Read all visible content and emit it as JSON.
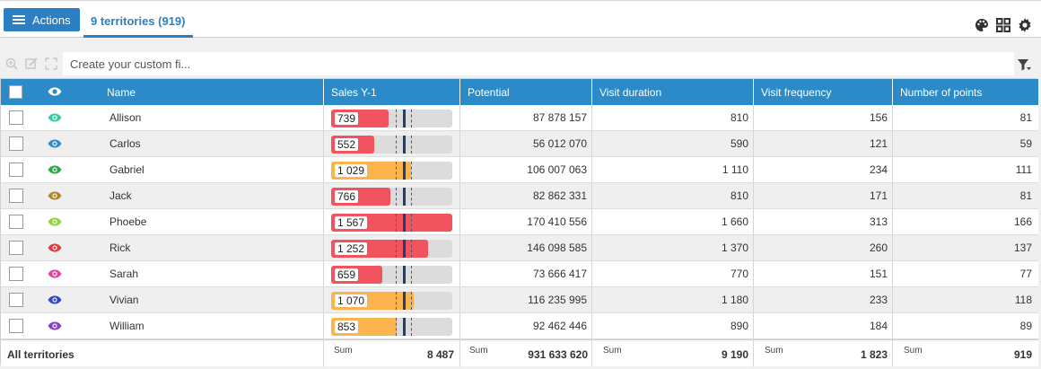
{
  "toolbar": {
    "actions_label": "Actions",
    "tab_label": "9 territories (919)"
  },
  "filter": {
    "placeholder": "Create your custom fi..."
  },
  "columns": [
    "Name",
    "Sales Y-1",
    "Potential",
    "Visit duration",
    "Visit frequency",
    "Number of points"
  ],
  "colors": {
    "header": "#2a8bc8",
    "accent": "#2b7fc2",
    "bar_red": "#f2545f",
    "bar_orange": "#fbb44e",
    "bar_track": "#dcdcdc",
    "target_marker": "#1f3f73"
  },
  "bar_max": 1567,
  "rows": [
    {
      "name": "Allison",
      "eye_color": "#3cc9a6",
      "sales": "739",
      "sales_value": 739,
      "bar_color": "#f2545f",
      "potential": "87 878 157",
      "visit_duration": "810",
      "visit_frequency": "156",
      "points": "81"
    },
    {
      "name": "Carlos",
      "eye_color": "#2e8fc9",
      "sales": "552",
      "sales_value": 552,
      "bar_color": "#f2545f",
      "potential": "56 012 070",
      "visit_duration": "590",
      "visit_frequency": "121",
      "points": "59"
    },
    {
      "name": "Gabriel",
      "eye_color": "#2ea84a",
      "sales": "1 029",
      "sales_value": 1029,
      "bar_color": "#fbb44e",
      "potential": "106 007 063",
      "visit_duration": "1 110",
      "visit_frequency": "234",
      "points": "111"
    },
    {
      "name": "Jack",
      "eye_color": "#b0852d",
      "sales": "766",
      "sales_value": 766,
      "bar_color": "#f2545f",
      "potential": "82 862 331",
      "visit_duration": "810",
      "visit_frequency": "171",
      "points": "81"
    },
    {
      "name": "Phoebe",
      "eye_color": "#8fd43e",
      "sales": "1 567",
      "sales_value": 1567,
      "bar_color": "#f2545f",
      "potential": "170 410 556",
      "visit_duration": "1 660",
      "visit_frequency": "313",
      "points": "166"
    },
    {
      "name": "Rick",
      "eye_color": "#e53a3a",
      "sales": "1 252",
      "sales_value": 1252,
      "bar_color": "#f2545f",
      "potential": "146 098 585",
      "visit_duration": "1 370",
      "visit_frequency": "260",
      "points": "137"
    },
    {
      "name": "Sarah",
      "eye_color": "#e0459e",
      "sales": "659",
      "sales_value": 659,
      "bar_color": "#f2545f",
      "potential": "73 666 417",
      "visit_duration": "770",
      "visit_frequency": "151",
      "points": "77"
    },
    {
      "name": "Vivian",
      "eye_color": "#3344c4",
      "sales": "1 070",
      "sales_value": 1070,
      "bar_color": "#fbb44e",
      "potential": "116 235 995",
      "visit_duration": "1 180",
      "visit_frequency": "233",
      "points": "118"
    },
    {
      "name": "William",
      "eye_color": "#8a3fbf",
      "sales": "853",
      "sales_value": 853,
      "bar_color": "#fbb44e",
      "potential": "92 462 446",
      "visit_duration": "890",
      "visit_frequency": "184",
      "points": "89"
    }
  ],
  "footer": {
    "label": "All territories",
    "sum_label": "Sum",
    "sales_sum": "8 487",
    "potential_sum": "931 633 620",
    "visit_duration_sum": "9 190",
    "visit_frequency_sum": "1 823",
    "points_sum": "919"
  }
}
